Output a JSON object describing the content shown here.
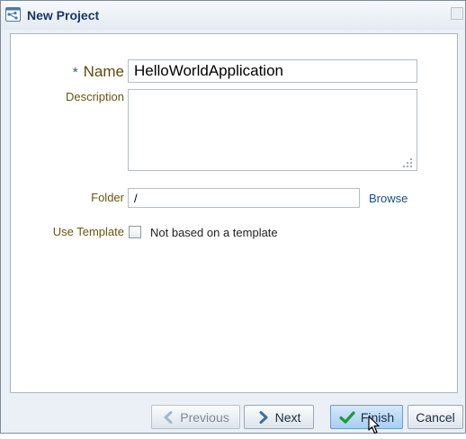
{
  "window": {
    "title": "New Project"
  },
  "form": {
    "name_label": "Name",
    "name_required_mark": "*",
    "name_value": "HelloWorldApplication",
    "description_label": "Description",
    "description_value": "",
    "folder_label": "Folder",
    "folder_value": "/",
    "browse_label": "Browse",
    "template_label": "Use Template",
    "template_checkbox_label": "Not based on a template",
    "template_checked": false
  },
  "footer": {
    "previous_label": "Previous",
    "next_label": "Next",
    "finish_label": "Finish",
    "cancel_label": "Cancel"
  },
  "colors": {
    "title_text": "#17385f",
    "label_text": "#6a5412",
    "link": "#1a4f86",
    "finish_check": "#1f9a3a",
    "nav_arrow": "#3a6ea5"
  },
  "icons": {
    "app": "project-wizard-icon",
    "close": "close-icon",
    "previous": "chevron-left-icon",
    "next": "chevron-right-icon",
    "finish": "checkmark-icon",
    "cursor": "mouse-pointer-icon"
  }
}
